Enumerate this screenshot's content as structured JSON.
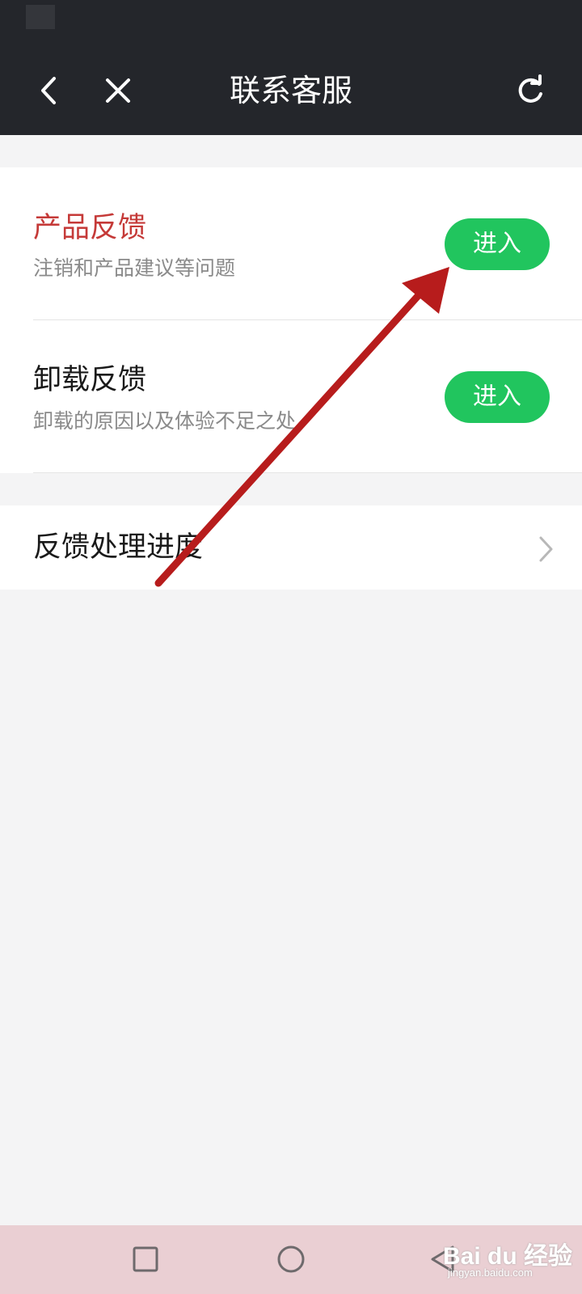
{
  "header": {
    "title": "联系客服",
    "back_icon": "chevron-left-icon",
    "close_icon": "close-icon",
    "refresh_icon": "refresh-icon"
  },
  "feedback_items": [
    {
      "title": "产品反馈",
      "subtitle": "注销和产品建议等问题",
      "button": "进入",
      "title_color": "#c53a38"
    },
    {
      "title": "卸载反馈",
      "subtitle": "卸载的原因以及体验不足之处",
      "button": "进入",
      "title_color": "#1a1a1a"
    }
  ],
  "progress_row": {
    "label": "反馈处理进度",
    "icon": "chevron-right-icon"
  },
  "colors": {
    "accent": "#21c55e",
    "header_bg": "#24262b",
    "highlight": "#c53a38",
    "annotation_arrow": "#b71c1c"
  },
  "system_nav": {
    "buttons": [
      "square-icon",
      "circle-icon",
      "triangle-back-icon"
    ]
  },
  "watermark": {
    "text": "Bai du 经验",
    "url": "jingyan.baidu.com"
  }
}
